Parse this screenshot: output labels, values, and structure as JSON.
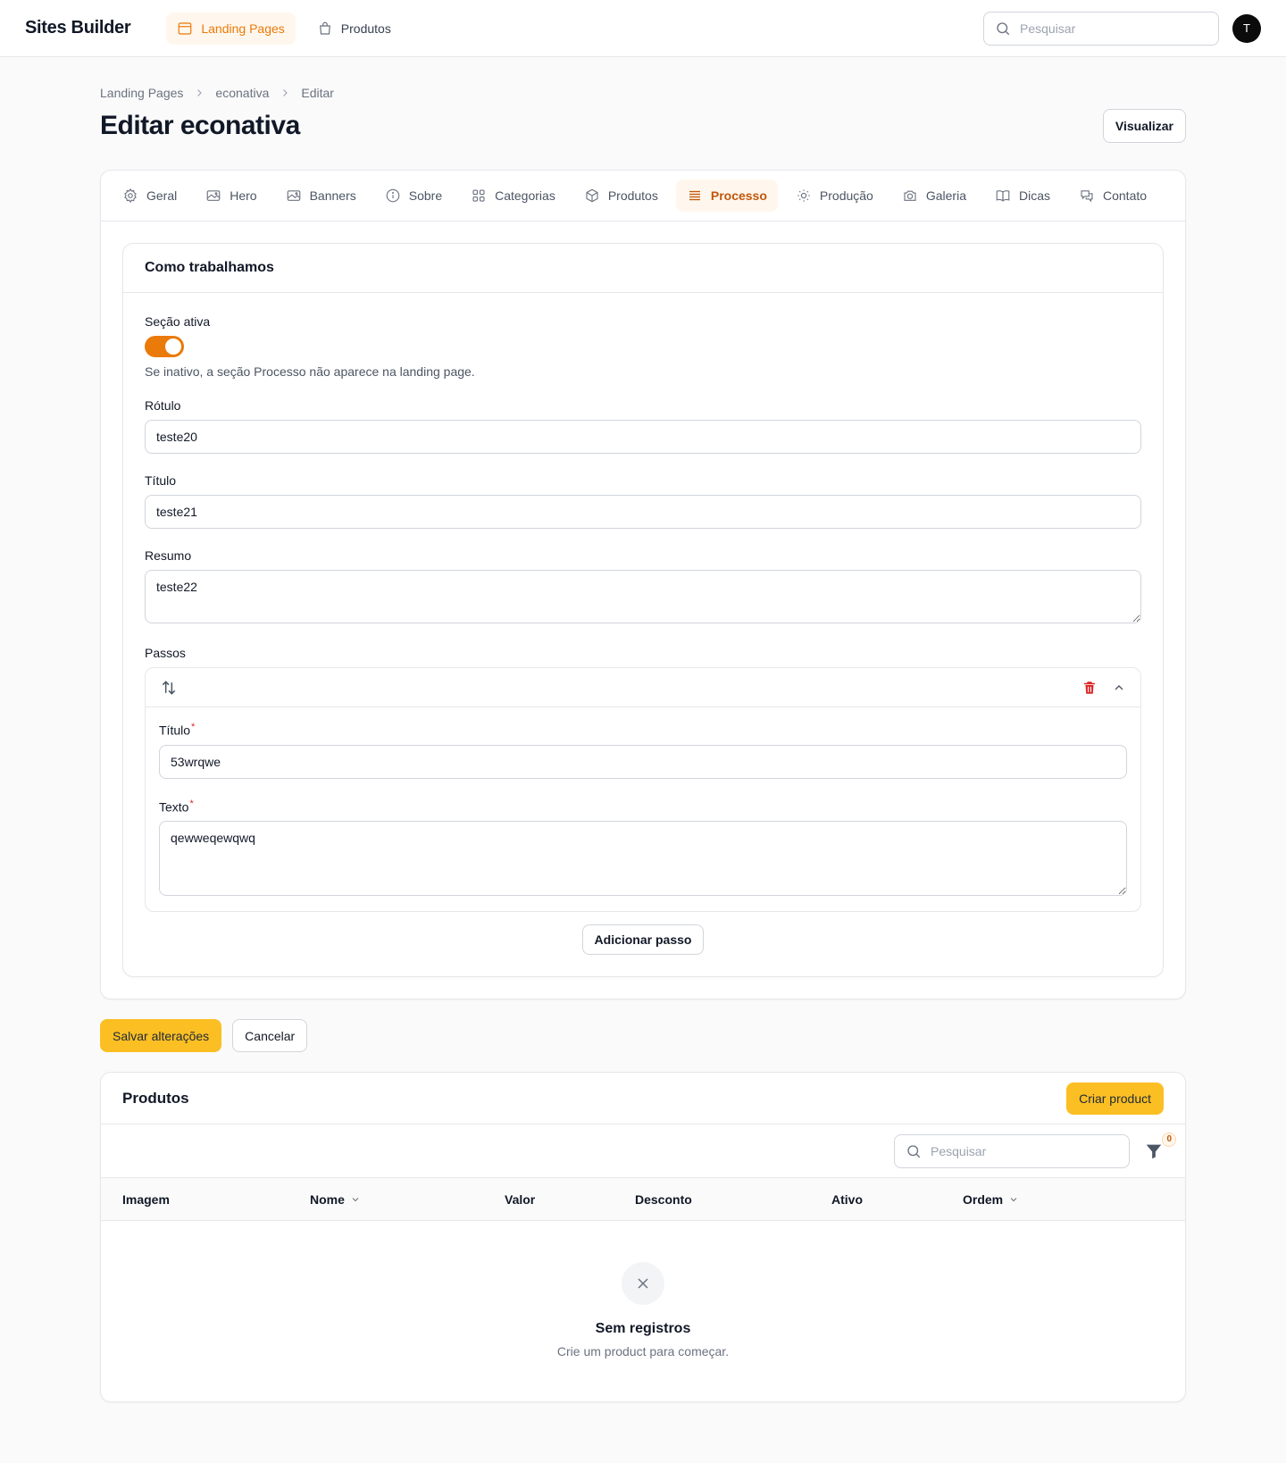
{
  "app": {
    "brand": "Sites Builder",
    "nav": [
      {
        "label": "Landing Pages",
        "icon": "layout-icon",
        "active": true
      },
      {
        "label": "Produtos",
        "icon": "shopping-bag-icon",
        "active": false
      }
    ],
    "search_placeholder": "Pesquisar",
    "avatar_initial": "T"
  },
  "breadcrumb": [
    "Landing Pages",
    "econativa",
    "Editar"
  ],
  "page": {
    "title": "Editar econativa",
    "view_button": "Visualizar"
  },
  "tabs": [
    {
      "label": "Geral",
      "icon": "gear-icon"
    },
    {
      "label": "Hero",
      "icon": "image-icon"
    },
    {
      "label": "Banners",
      "icon": "image-icon"
    },
    {
      "label": "Sobre",
      "icon": "info-icon"
    },
    {
      "label": "Categorias",
      "icon": "grid-icon"
    },
    {
      "label": "Produtos",
      "icon": "cube-icon"
    },
    {
      "label": "Processo",
      "icon": "list-icon",
      "active": true
    },
    {
      "label": "Produção",
      "icon": "sun-icon"
    },
    {
      "label": "Galeria",
      "icon": "camera-icon"
    },
    {
      "label": "Dicas",
      "icon": "book-icon"
    },
    {
      "label": "Contato",
      "icon": "chat-icon"
    }
  ],
  "section": {
    "title": "Como trabalhamos",
    "active_label": "Seção ativa",
    "active": true,
    "active_helper": "Se inativo, a seção Processo não aparece na landing page.",
    "rotulo_label": "Rótulo",
    "rotulo_value": "teste20",
    "titulo_label": "Título",
    "titulo_value": "teste21",
    "resumo_label": "Resumo",
    "resumo_value": "teste22",
    "passos_label": "Passos",
    "step": {
      "titulo_label": "Título",
      "titulo_value": "53wrqwe",
      "texto_label": "Texto",
      "texto_value": "qewweqewqwq",
      "required_mark": "*"
    },
    "add_step_button": "Adicionar passo"
  },
  "form_actions": {
    "save": "Salvar alterações",
    "cancel": "Cancelar"
  },
  "products": {
    "title": "Produtos",
    "create_button": "Criar product",
    "search_placeholder": "Pesquisar",
    "filter_count": "0",
    "columns": [
      {
        "label": "Imagem",
        "sortable": false
      },
      {
        "label": "Nome",
        "sortable": true
      },
      {
        "label": "Valor",
        "sortable": false
      },
      {
        "label": "Desconto",
        "sortable": false
      },
      {
        "label": "Ativo",
        "sortable": false
      },
      {
        "label": "Ordem",
        "sortable": true
      }
    ],
    "empty_title": "Sem registros",
    "empty_desc": "Crie um product para começar."
  },
  "colors": {
    "accent": "#ea7a0a",
    "primary_button": "#fbbf24",
    "danger": "#dc2626"
  }
}
